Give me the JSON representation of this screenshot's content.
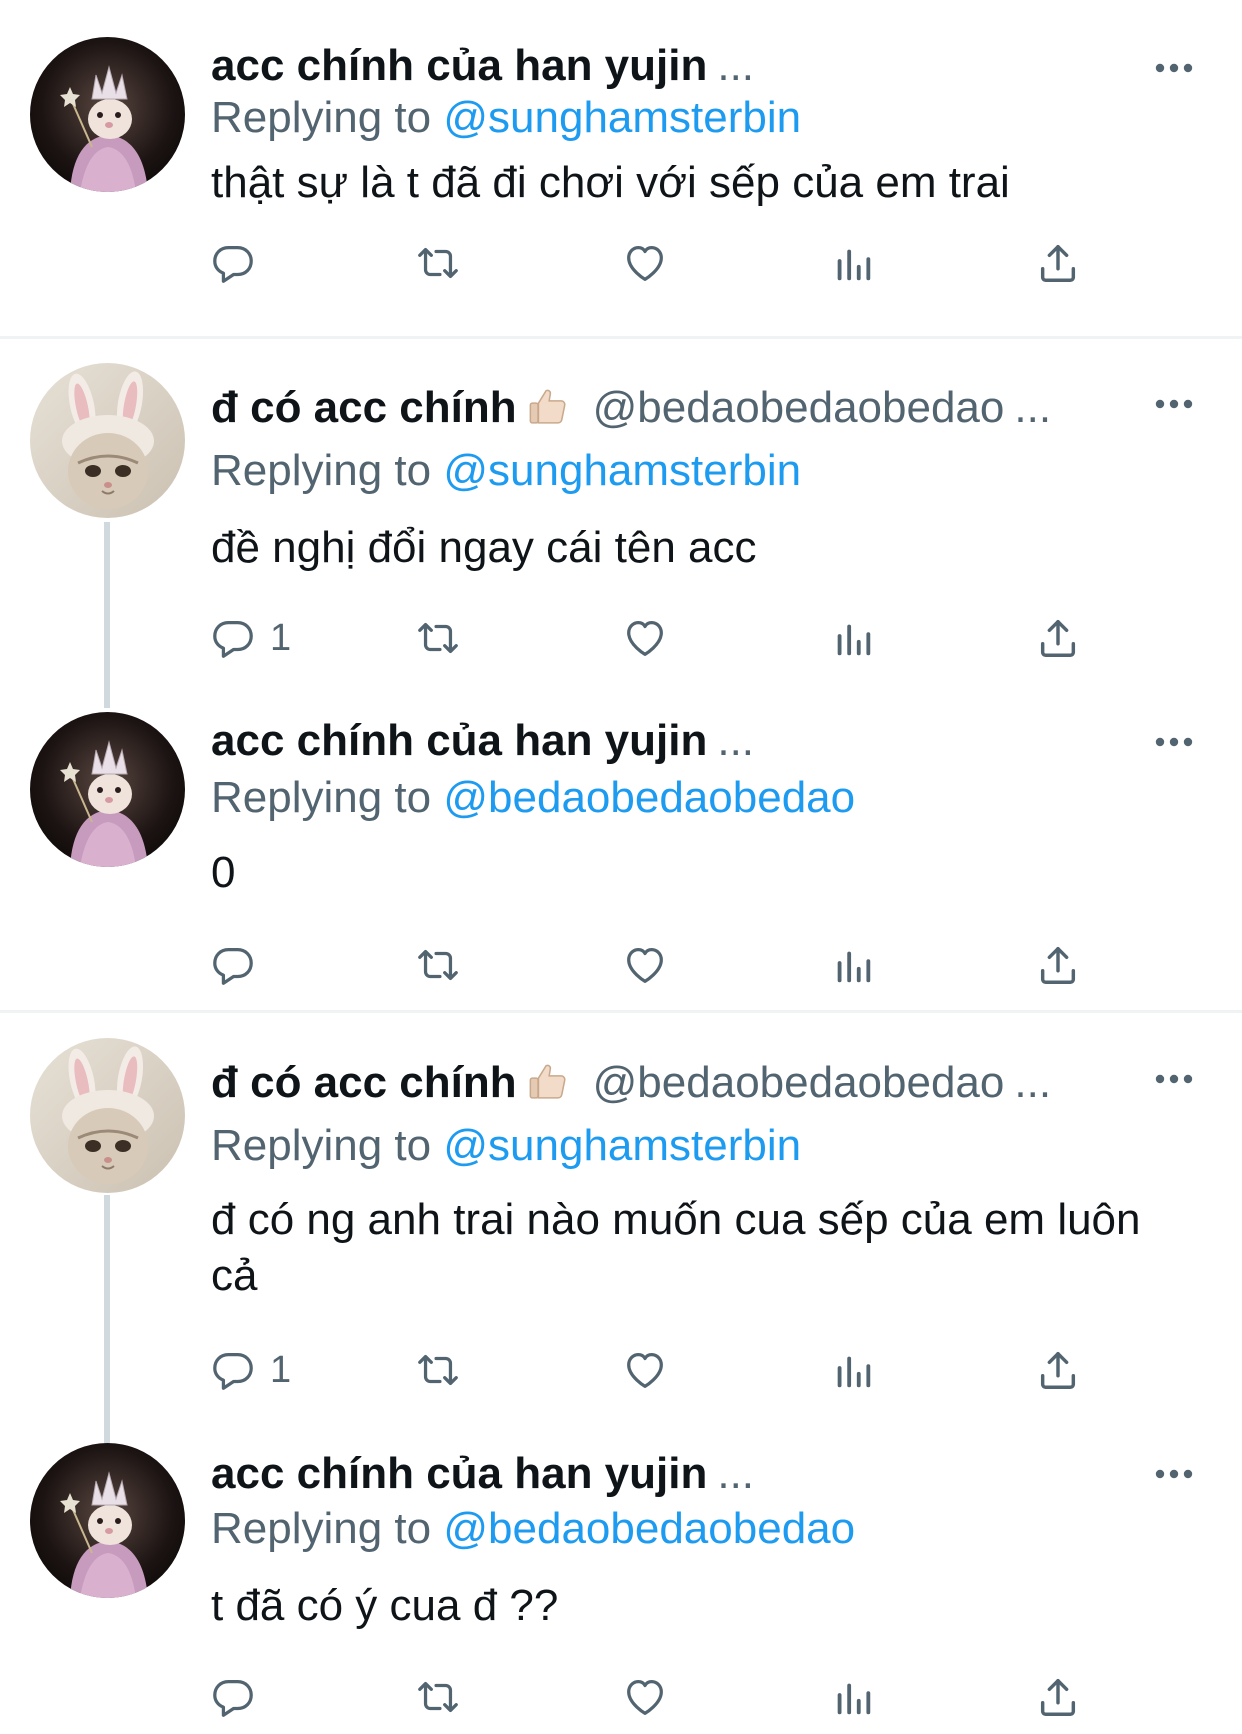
{
  "tweets": [
    {
      "author": "acc chính của han yujin",
      "handle": "",
      "ellipsis": "...",
      "replying_label": "Replying to",
      "replying_to": "@sunghamsterbin",
      "text": "thật sự là t đã đi chơi với sếp của em trai",
      "reply_count": ""
    },
    {
      "author": "đ có acc chính",
      "handle": "@bedaobedaobedao",
      "ellipsis": "...",
      "replying_label": "Replying to",
      "replying_to": "@sunghamsterbin",
      "text": "đề nghị đổi ngay cái tên acc",
      "reply_count": "1"
    },
    {
      "author": "acc chính của han yujin",
      "handle": "",
      "ellipsis": "...",
      "replying_label": "Replying to",
      "replying_to": "@bedaobedaobedao",
      "text": "0",
      "reply_count": ""
    },
    {
      "author": "đ có acc chính",
      "handle": "@bedaobedaobedao",
      "ellipsis": "...",
      "replying_label": "Replying to",
      "replying_to": "@sunghamsterbin",
      "text": "đ có ng anh trai nào muốn cua sếp của em luôn cả",
      "reply_count": "1"
    },
    {
      "author": "acc chính của han yujin",
      "handle": "",
      "ellipsis": "...",
      "replying_label": "Replying to",
      "replying_to": "@bedaobedaobedao",
      "text": "t đã có ý cua đ ??",
      "reply_count": ""
    }
  ],
  "icons": {
    "reply": "reply-icon",
    "retweet": "retweet-icon",
    "like": "like-icon",
    "views": "views-icon",
    "share": "share-icon",
    "more": "more-icon",
    "emoji": "thumbs-up-emoji"
  },
  "colors": {
    "mention": "#1d9bf0",
    "secondary_text": "#536471",
    "thread_line": "#cfd9de"
  }
}
